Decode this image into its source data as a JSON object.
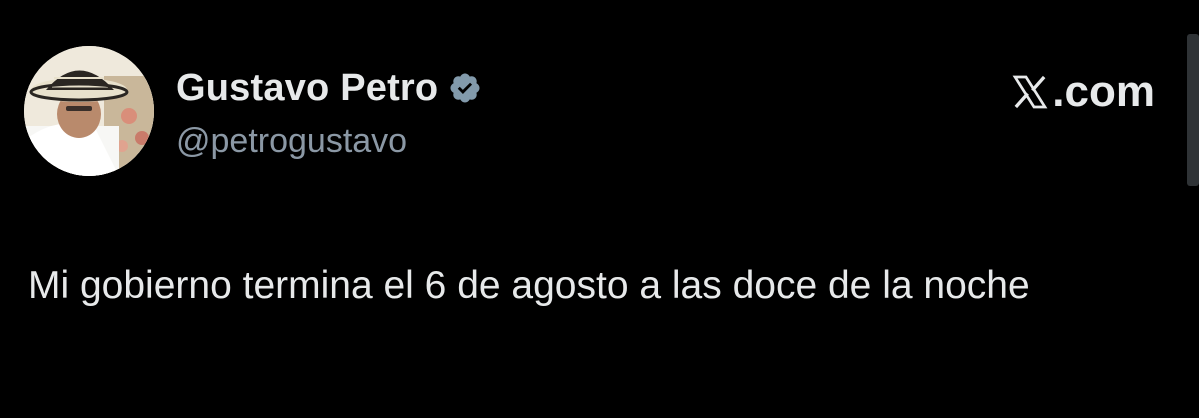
{
  "tweet": {
    "author": {
      "display_name": "Gustavo Petro",
      "handle": "@petrogustavo",
      "verified": true,
      "avatar_icon": "profile-photo"
    },
    "source": {
      "logo_icon": "x-logo-icon",
      "domain_label": ".com"
    },
    "text": "Mi gobierno termina el 6 de agosto a las doce de la noche"
  },
  "colors": {
    "background": "#000000",
    "primary_text": "#e7e9ea",
    "secondary_text": "#8b98a5",
    "verified_badge": "#829aab"
  }
}
